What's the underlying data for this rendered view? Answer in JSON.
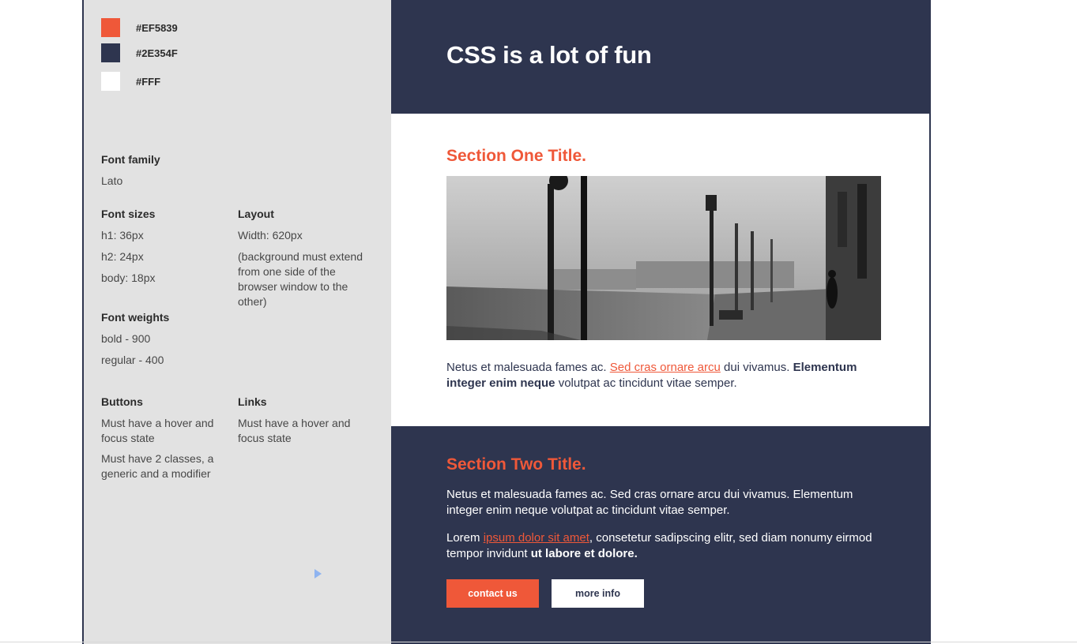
{
  "colors": {
    "accent": "#EF5839",
    "dark": "#2E354F",
    "white": "#FFFFFF",
    "panel": "#E2E2E2"
  },
  "guide": {
    "swatches": [
      {
        "label": "#EF5839",
        "color": "#EF5839"
      },
      {
        "label": "#2E354F",
        "color": "#2E354F"
      },
      {
        "label": "#FFF",
        "color": "#FFFFFF"
      }
    ],
    "font_family": {
      "heading": "Font family",
      "value": "Lato"
    },
    "font_sizes": {
      "heading": "Font sizes",
      "h1": "h1: 36px",
      "h2": "h2: 24px",
      "body": "body: 18px"
    },
    "layout": {
      "heading": "Layout",
      "width": "Width: 620px",
      "note": "(background must extend from one side of the browser window to the other)"
    },
    "font_weights": {
      "heading": "Font weights",
      "bold": "bold - 900",
      "regular": "regular - 400"
    },
    "buttons": {
      "heading": "Buttons",
      "rule1": "Must have a hover and focus state",
      "rule2": "Must have 2 classes, a generic and a modifier"
    },
    "links": {
      "heading": "Links",
      "rule1": "Must have a hover and focus state"
    }
  },
  "mockup": {
    "hero_title": "CSS is a lot of fun",
    "section_one": {
      "title": "Section One Title.",
      "p_start": "Netus et malesuada fames ac. ",
      "p_link": "Sed cras ornare arcu",
      "p_mid": " dui vivamus. ",
      "p_bold": "Elementum integer enim neque",
      "p_end": " volutpat ac tincidunt vitae semper."
    },
    "section_two": {
      "title": "Section Two Title.",
      "p1": "Netus et malesuada fames ac. Sed cras ornare arcu dui vivamus. Elementum integer enim neque volutpat ac tincidunt vitae semper.",
      "p2_start": "Lorem ",
      "p2_link": "ipsum dolor sit amet",
      "p2_mid": ", consetetur sadipscing elitr, sed diam nonumy eirmod tempor invidunt ",
      "p2_bold": "ut labore et dolore.",
      "btn_primary": "contact us",
      "btn_secondary": "more info"
    }
  }
}
